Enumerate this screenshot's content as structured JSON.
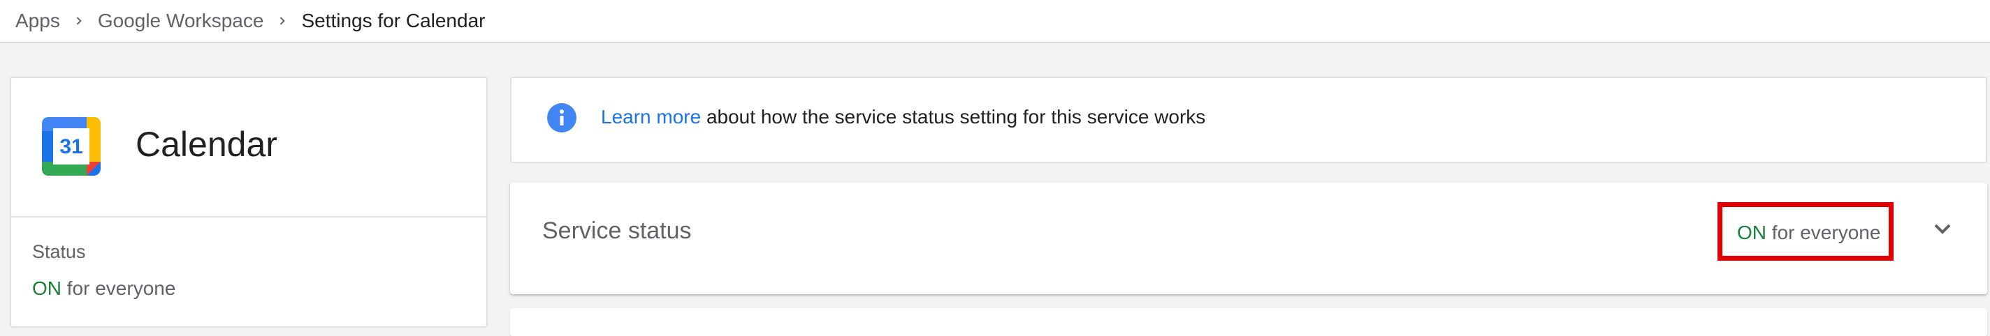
{
  "breadcrumb": {
    "items": [
      "Apps",
      "Google Workspace"
    ],
    "current": "Settings for Calendar"
  },
  "app": {
    "name": "Calendar",
    "logo_text": "31",
    "status_label": "Status",
    "status_on": "ON",
    "status_rest": "for everyone"
  },
  "info": {
    "link_text": "Learn more",
    "text": "about how the service status setting for this service works"
  },
  "service_status": {
    "title": "Service status",
    "status_on": "ON",
    "status_rest": "for everyone"
  },
  "colors": {
    "on_green": "#188038",
    "link_blue": "#1a73e8",
    "highlight_red": "#e00000"
  },
  "icons": {
    "breadcrumb_separator": "chevron-right-icon",
    "info": "info-icon",
    "expand": "chevron-down-icon"
  }
}
